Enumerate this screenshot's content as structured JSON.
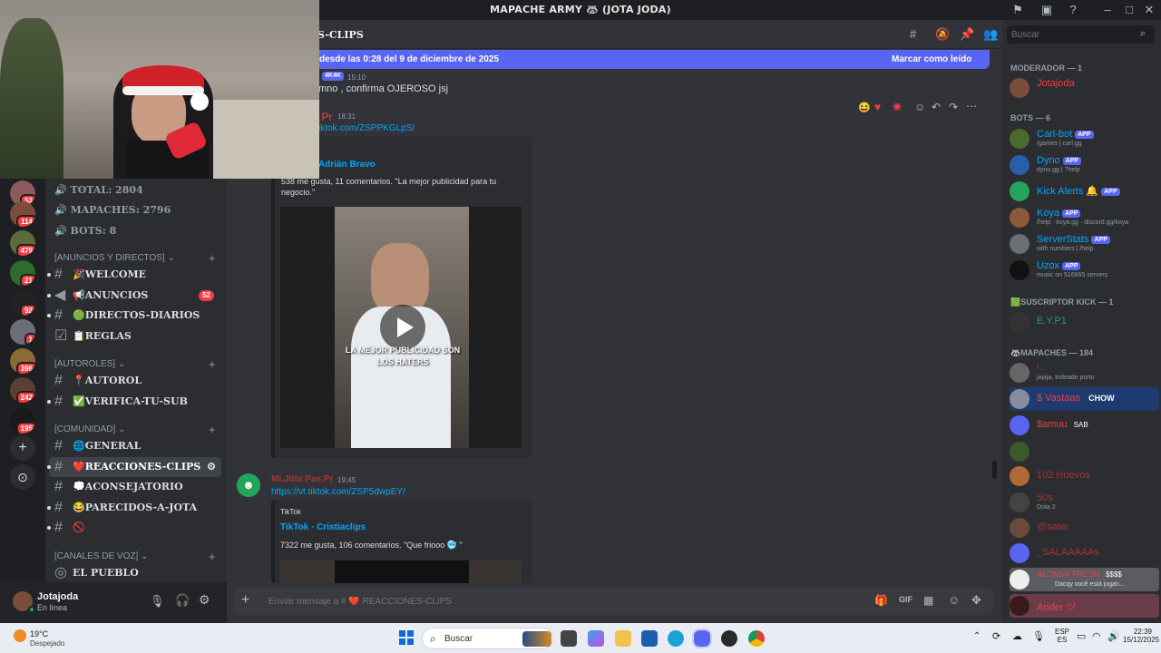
{
  "window": {
    "title": "MAPACHE ARMY 🦝 (JOTA JODA)"
  },
  "header": {
    "channel": "S-CLIPS"
  },
  "newbar": {
    "text": "desde las 0:28 del 9 de diciembre de 2025",
    "action": "Marcar como leído"
  },
  "servers": [
    {
      "badge": "53"
    },
    {
      "badge": "114"
    },
    {
      "badge": "479"
    },
    {
      "badge": "21"
    },
    {
      "badge": "92"
    },
    {
      "badge": "1"
    },
    {
      "badge": "396"
    },
    {
      "badge": "242"
    },
    {
      "badge": "195"
    }
  ],
  "stats": {
    "total": "TOTAL: 2804",
    "mapaches": "MAPACHES: 2796",
    "bots": "BOTS: 8"
  },
  "categories": {
    "anuncios": "[ANUNCIOS Y DIRECTOS]",
    "autoroles": "[AUTOROLES]",
    "comunidad": "[COMUNIDAD]",
    "voz": "[CANALES DE VOZ]"
  },
  "channels": {
    "welcome": "🎉WELCOME",
    "anuncios": "📢ANUNCIOS",
    "anuncios_count": "52",
    "directos": "🟢DIRECTOS-DIARIOS",
    "reglas": "📋REGLAS",
    "autorol": "📍AUTOROL",
    "verifica": "✅VERIFICA-TU-SUB",
    "general": "🌐GENERAL",
    "reacciones": "❤️REACCIONES-CLIPS",
    "aconsejatorio": "💭ACONSEJATORIO",
    "parecidos": "😂PARECIDOS-A-JOTA",
    "noname": "🚫",
    "pueblo": "EL PUEBLO"
  },
  "user": {
    "name": "Jotajoda",
    "status": "En línea"
  },
  "messages": [
    {
      "tag": "4K4K",
      "time": "15:10",
      "text": "mno , confirma OJEROSO jsj"
    },
    {
      "author": ".Pr",
      "time": "18:31",
      "link": "iktok.com/ZSPPKGLpS/",
      "embed_author": "Adrián Bravo",
      "embed_text": "538 me gusta, 11 comentarios. \"La mejor publicidad para tu negocio.\"",
      "overlay": "LA MEJOR PUBLICIDAD SON LOS HATERS"
    },
    {
      "author": "Mi.Jtita Pas.Pr",
      "time": "19:45",
      "link": "https://vt.tiktok.com/ZSP5dwpEY/",
      "embed_provider": "TikTok",
      "embed_author": "TikTok · Cristiaclips",
      "embed_text": "7322 me gusta, 106 comentarios. \"Que friooo 🥶 \""
    }
  ],
  "composer": {
    "placeholder": "Enviar mensaje a # ❤️ REACCIONES-CLIPS"
  },
  "search": {
    "placeholder": "Buscar"
  },
  "members": {
    "moderador_head": "Moderador — 1",
    "moderador": [
      {
        "name": "Jotajoda",
        "color": "#f23f43"
      }
    ],
    "bots_head": "BOTS — 6",
    "bots": [
      {
        "name": "Carl-bot",
        "sub": "/games | carl.gg",
        "app": "APP"
      },
      {
        "name": "Dyno",
        "sub": "dyno.gg | ?help",
        "app": "APP"
      },
      {
        "name": "Kick Alerts 🔔",
        "sub": "",
        "app": "APP"
      },
      {
        "name": "Koya",
        "sub": "/help · koya.gg · discord.gg/koya",
        "app": "APP"
      },
      {
        "name": "ServerStats",
        "sub": "with numbers | /help",
        "app": "APP"
      },
      {
        "name": "Uzox",
        "sub": "music on 516865 servers",
        "app": "APP"
      }
    ],
    "kick_head": "🟩SUSCRIPTOR KICK — 1",
    "kick": [
      {
        "name": "E.Y.P1"
      }
    ],
    "mapaches_head": "🦝MAPACHES — 184",
    "mapaches": [
      {
        "name": "!...",
        "sub": "jajaja, troleado purto"
      },
      {
        "name": "$ Vastaas",
        "tag": "CHOW"
      },
      {
        "name": "$amuu",
        "tag": "SAB"
      },
      {
        "name": ""
      },
      {
        "name": "102 Huevos"
      },
      {
        "name": "50s",
        "sub": "Dota 2"
      },
      {
        "name": "@sater"
      },
      {
        "name": "_SALAAAAAs"
      },
      {
        "name": "ALONSX FRESH",
        "tag": "$$$$",
        "sub": "Dacqy você está jogan..."
      },
      {
        "name": "Ander ツ"
      }
    ]
  },
  "taskbar": {
    "weather_temp": "19°C",
    "weather_desc": "Despejado",
    "search": "Buscar",
    "lang1": "ESP",
    "lang2": "ES",
    "time": "22:39",
    "date": "15/12/2025"
  },
  "colors": {
    "accent": "#5865f2",
    "link": "#00a8fc",
    "danger": "#f23f43",
    "online": "#23a55a"
  }
}
